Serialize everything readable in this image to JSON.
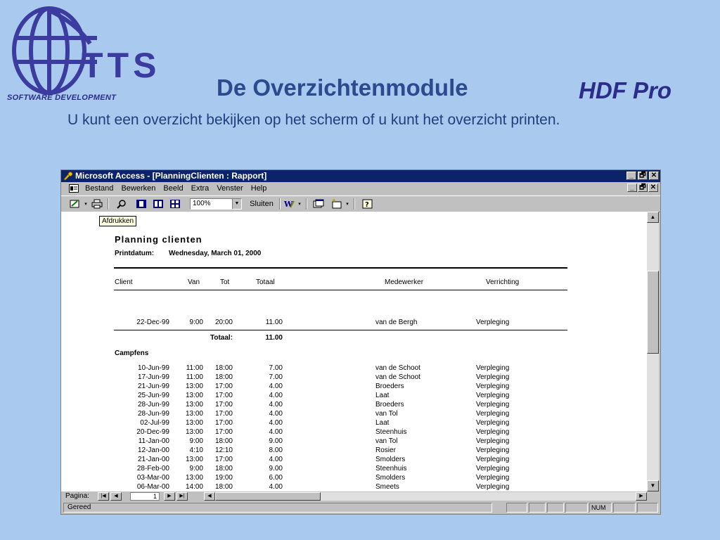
{
  "slide": {
    "logo_text": "TTS",
    "logo_tagline": "SOFTWARE DEVELOPMENT",
    "title": "De Overzichtenmodule",
    "brand": "HDF Pro",
    "subtitle": "U kunt een overzicht bekijken op het scherm of u kunt het overzicht printen."
  },
  "window": {
    "title": "Microsoft Access - [PlanningClienten : Rapport]",
    "caption_buttons": [
      "_",
      "🗗",
      "✕"
    ],
    "menu": [
      "Bestand",
      "Bewerken",
      "Beeld",
      "Extra",
      "Venster",
      "Help"
    ],
    "toolbar": {
      "zoom": "100%",
      "close_label": "Sluiten"
    },
    "tooltip": "Afdrukken"
  },
  "report": {
    "title": "Planning clienten",
    "printdate_label": "Printdatum:",
    "printdate_value": "Wednesday, March 01, 2000",
    "headers": {
      "client": "Client",
      "van": "Van",
      "tot": "Tot",
      "totaal": "Totaal",
      "medewerker": "Medewerker",
      "verrichting": "Verrichting"
    },
    "prev_group_rows": [
      {
        "date": "22-Dec-99",
        "van": "9:00",
        "tot": "20:00",
        "totaal": "11.00",
        "medewerker": "van de Bergh",
        "verrichting": "Verpleging"
      }
    ],
    "prev_total_label": "Totaal:",
    "prev_total_value": "11.00",
    "group_name": "Campfens",
    "rows": [
      {
        "date": "10-Jun-99",
        "van": "11:00",
        "tot": "18:00",
        "totaal": "7.00",
        "medewerker": "van de Schoot",
        "verrichting": "Verpleging"
      },
      {
        "date": "17-Jun-99",
        "van": "11:00",
        "tot": "18:00",
        "totaal": "7.00",
        "medewerker": "van de Schoot",
        "verrichting": "Verpleging"
      },
      {
        "date": "21-Jun-99",
        "van": "13:00",
        "tot": "17:00",
        "totaal": "4.00",
        "medewerker": "Broeders",
        "verrichting": "Verpleging"
      },
      {
        "date": "25-Jun-99",
        "van": "13:00",
        "tot": "17:00",
        "totaal": "4.00",
        "medewerker": "Laat",
        "verrichting": "Verpleging"
      },
      {
        "date": "28-Jun-99",
        "van": "13:00",
        "tot": "17:00",
        "totaal": "4.00",
        "medewerker": "Broeders",
        "verrichting": "Verpleging"
      },
      {
        "date": "28-Jun-99",
        "van": "13:00",
        "tot": "17:00",
        "totaal": "4.00",
        "medewerker": "van Tol",
        "verrichting": "Verpleging"
      },
      {
        "date": "02-Jul-99",
        "van": "13:00",
        "tot": "17:00",
        "totaal": "4.00",
        "medewerker": "Laat",
        "verrichting": "Verpleging"
      },
      {
        "date": "20-Dec-99",
        "van": "13:00",
        "tot": "17:00",
        "totaal": "4.00",
        "medewerker": "Steenhuis",
        "verrichting": "Verpleging"
      },
      {
        "date": "11-Jan-00",
        "van": "9:00",
        "tot": "18:00",
        "totaal": "9.00",
        "medewerker": "van Tol",
        "verrichting": "Verpleging"
      },
      {
        "date": "12-Jan-00",
        "van": "4:10",
        "tot": "12:10",
        "totaal": "8.00",
        "medewerker": "Rosier",
        "verrichting": "Verpleging"
      },
      {
        "date": "21-Jan-00",
        "van": "13:00",
        "tot": "17:00",
        "totaal": "4.00",
        "medewerker": "Smolders",
        "verrichting": "Verpleging"
      },
      {
        "date": "28-Feb-00",
        "van": "9:00",
        "tot": "18:00",
        "totaal": "9.00",
        "medewerker": "Steenhuis",
        "verrichting": "Verpleging"
      },
      {
        "date": "03-Mar-00",
        "van": "13:00",
        "tot": "19:00",
        "totaal": "6.00",
        "medewerker": "Smolders",
        "verrichting": "Verpleging"
      },
      {
        "date": "06-Mar-00",
        "van": "14:00",
        "tot": "18:00",
        "totaal": "4.00",
        "medewerker": "Smeets",
        "verrichting": "Verpleging"
      }
    ]
  },
  "navigation": {
    "page_label": "Pagina:",
    "page_value": "1"
  },
  "status": {
    "text": "Gereed",
    "num": "NUM"
  }
}
